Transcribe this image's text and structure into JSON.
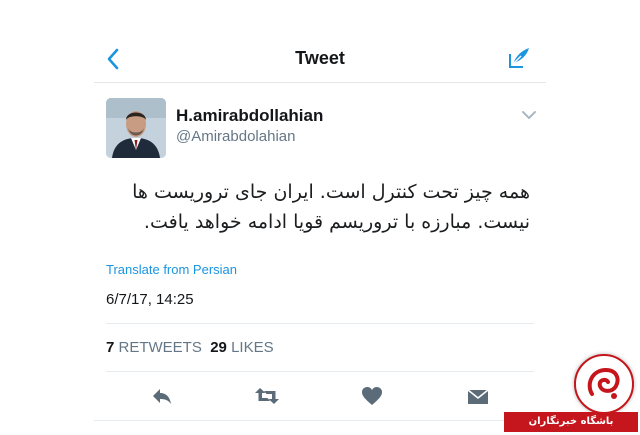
{
  "colors": {
    "accent": "#1b95e0",
    "text": "#14171a",
    "muted": "#657786",
    "watermark": "#c4161c"
  },
  "nav": {
    "title": "Tweet",
    "back_icon": "chevron-left-icon",
    "compose_icon": "compose-icon"
  },
  "author": {
    "name": "H.amirabdollahian",
    "handle": "@Amirabdolahian"
  },
  "tweet": {
    "text": "همه چیز تحت کنترل است. ایران جای تروریست ها نیست. مبارزه با تروریسم قویا ادامه خواهد یافت.",
    "translate_label": "Translate from Persian",
    "timestamp": "6/7/17, 14:25"
  },
  "stats": {
    "retweets_count": "7",
    "retweets_label": "RETWEETS",
    "likes_count": "29",
    "likes_label": "LIKES"
  },
  "actions": [
    "reply-icon",
    "retweet-icon",
    "heart-icon",
    "message-icon"
  ],
  "watermark": {
    "text": "باشگاه خبرنگاران"
  }
}
